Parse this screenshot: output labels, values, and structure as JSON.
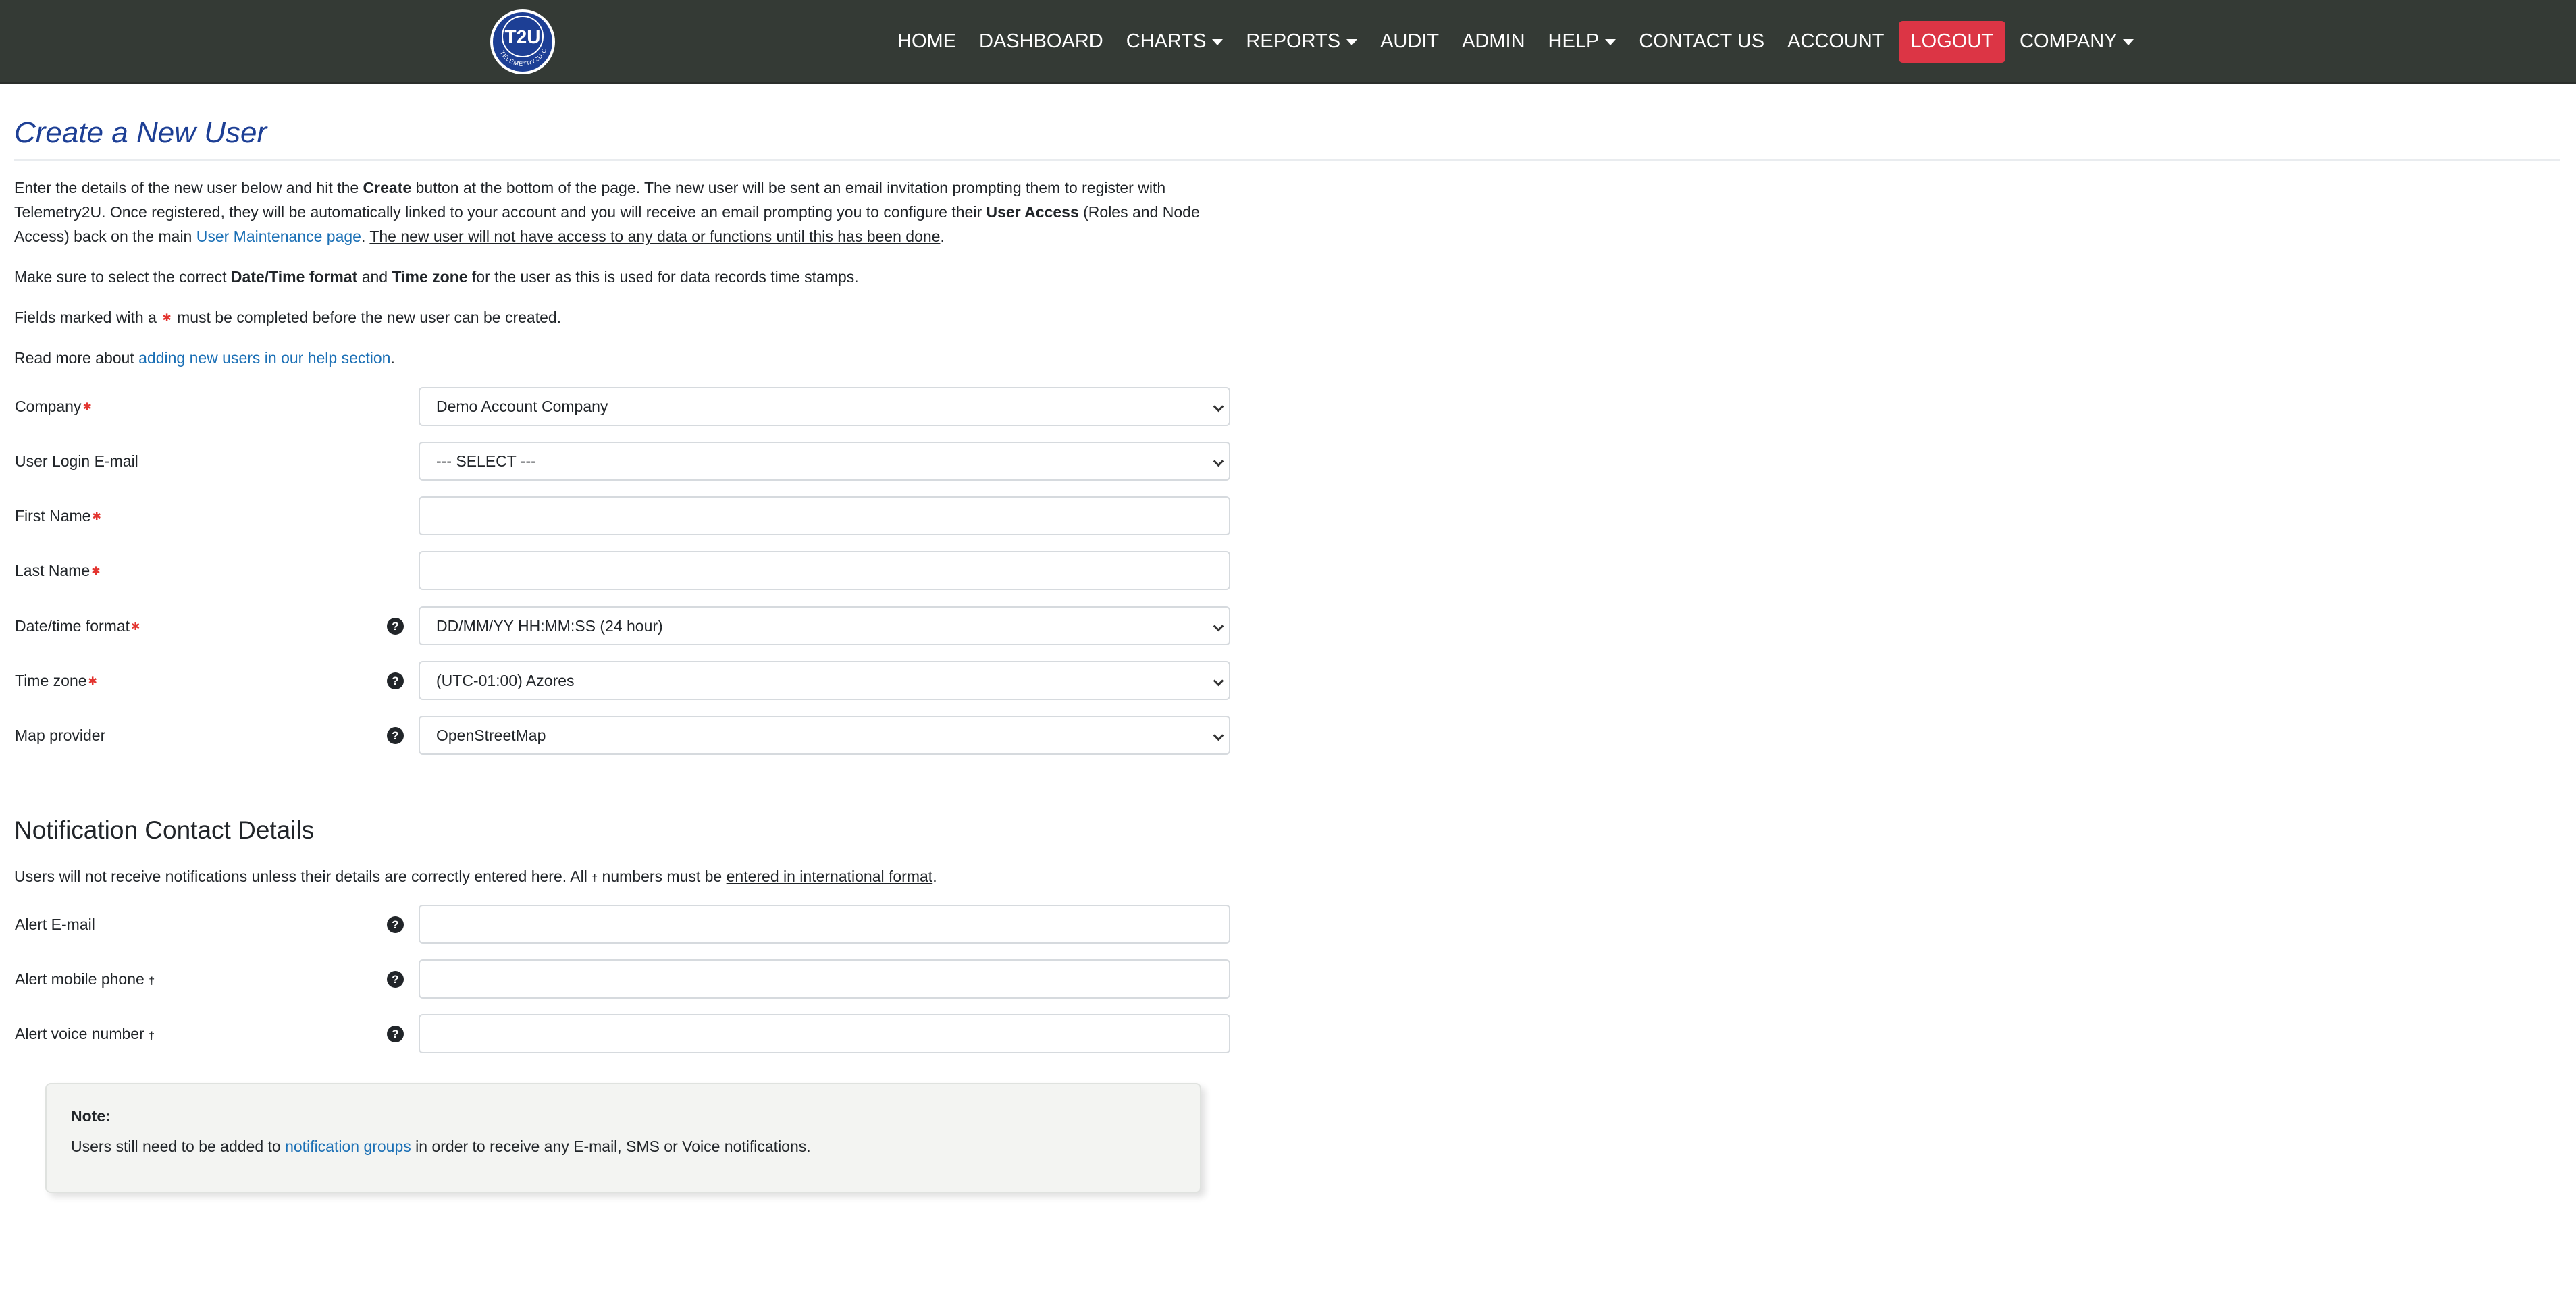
{
  "nav": {
    "logo_text": "T2U",
    "logo_ring_text": "TELEMETRY2U.COM",
    "items": [
      {
        "label": "HOME"
      },
      {
        "label": "DASHBOARD"
      },
      {
        "label": "CHARTS"
      },
      {
        "label": "REPORTS"
      },
      {
        "label": "AUDIT"
      },
      {
        "label": "ADMIN"
      },
      {
        "label": "HELP"
      },
      {
        "label": "CONTACT US"
      },
      {
        "label": "ACCOUNT"
      },
      {
        "label": "LOGOUT"
      },
      {
        "label": "COMPANY"
      }
    ]
  },
  "page": {
    "title": "Create a New User",
    "intro": {
      "p1_a": "Enter the details of the new user below and hit the ",
      "p1_b": "Create",
      "p1_c": " button at the bottom of the page. The new user will be sent an email invitation prompting them to register with Telemetry2U. Once registered, they will be automatically linked to your account and you will receive an email prompting you to configure their ",
      "p1_d": "User Access",
      "p1_e": " (Roles and Node Access) back on the main ",
      "p1_link": "User Maintenance page",
      "p1_f": ". ",
      "p1_u": "The new user will not have access to any data or functions until this has been done",
      "p1_g": ".",
      "p2_a": "Make sure to select the correct ",
      "p2_b": "Date/Time format",
      "p2_c": " and ",
      "p2_d": "Time zone",
      "p2_e": " for the user as this is used for data records time stamps.",
      "p3_a": "Fields marked with a ",
      "p3_b": " must be completed before the new user can be created.",
      "p4_a": "Read more about ",
      "p4_link": "adding new users in our help section",
      "p4_b": "."
    },
    "required_mark": "✱",
    "help_glyph": "?",
    "fields": {
      "company": {
        "label": "Company",
        "value": "Demo Account Company"
      },
      "login_email": {
        "label": "User Login E-mail",
        "value": "--- SELECT ---"
      },
      "first_name": {
        "label": "First Name",
        "value": ""
      },
      "last_name": {
        "label": "Last Name",
        "value": ""
      },
      "datetime": {
        "label": "Date/time format",
        "value": "DD/MM/YY HH:MM:SS (24 hour)"
      },
      "timezone": {
        "label": "Time zone",
        "value": "(UTC-01:00) Azores"
      },
      "map": {
        "label": "Map provider",
        "value": "OpenStreetMap"
      }
    },
    "notify": {
      "title": "Notification Contact Details",
      "text_a": "Users will not receive notifications unless their details are correctly entered here. All ",
      "dagger": "†",
      "text_b": " numbers must be ",
      "text_u": "entered in international format",
      "text_c": ".",
      "alert_email": {
        "label": "Alert E-mail",
        "value": ""
      },
      "alert_mobile": {
        "label": "Alert mobile phone",
        "value": ""
      },
      "alert_voice": {
        "label": "Alert voice number",
        "value": ""
      }
    },
    "note": {
      "title": "Note:",
      "text_a": "Users still need to be added to ",
      "link": "notification groups",
      "text_b": " in order to receive any E-mail, SMS or Voice notifications."
    }
  }
}
